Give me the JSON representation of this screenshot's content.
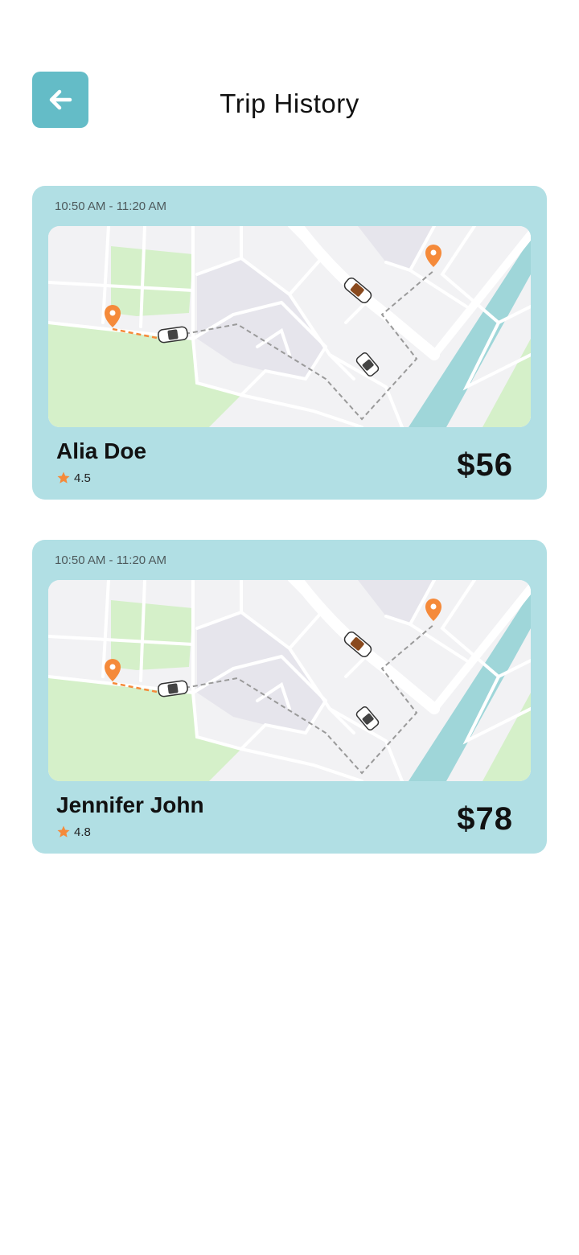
{
  "header": {
    "title": "Trip History",
    "back_icon": "arrow-left-icon",
    "accent_color": "#64bcc7"
  },
  "trips": [
    {
      "time": "10:50 AM - 11:20 AM",
      "driver_name": "Alia Doe",
      "rating": "4.5",
      "price": "$56"
    },
    {
      "time": "10:50 AM - 11:20 AM",
      "driver_name": "Jennifer John",
      "rating": "4.8",
      "price": "$78"
    }
  ],
  "colors": {
    "card_background": "#b1dfe4",
    "pin": "#f58a3a",
    "star": "#f58a3a",
    "park": "#d5f0c9",
    "water": "#9fd6d9"
  }
}
